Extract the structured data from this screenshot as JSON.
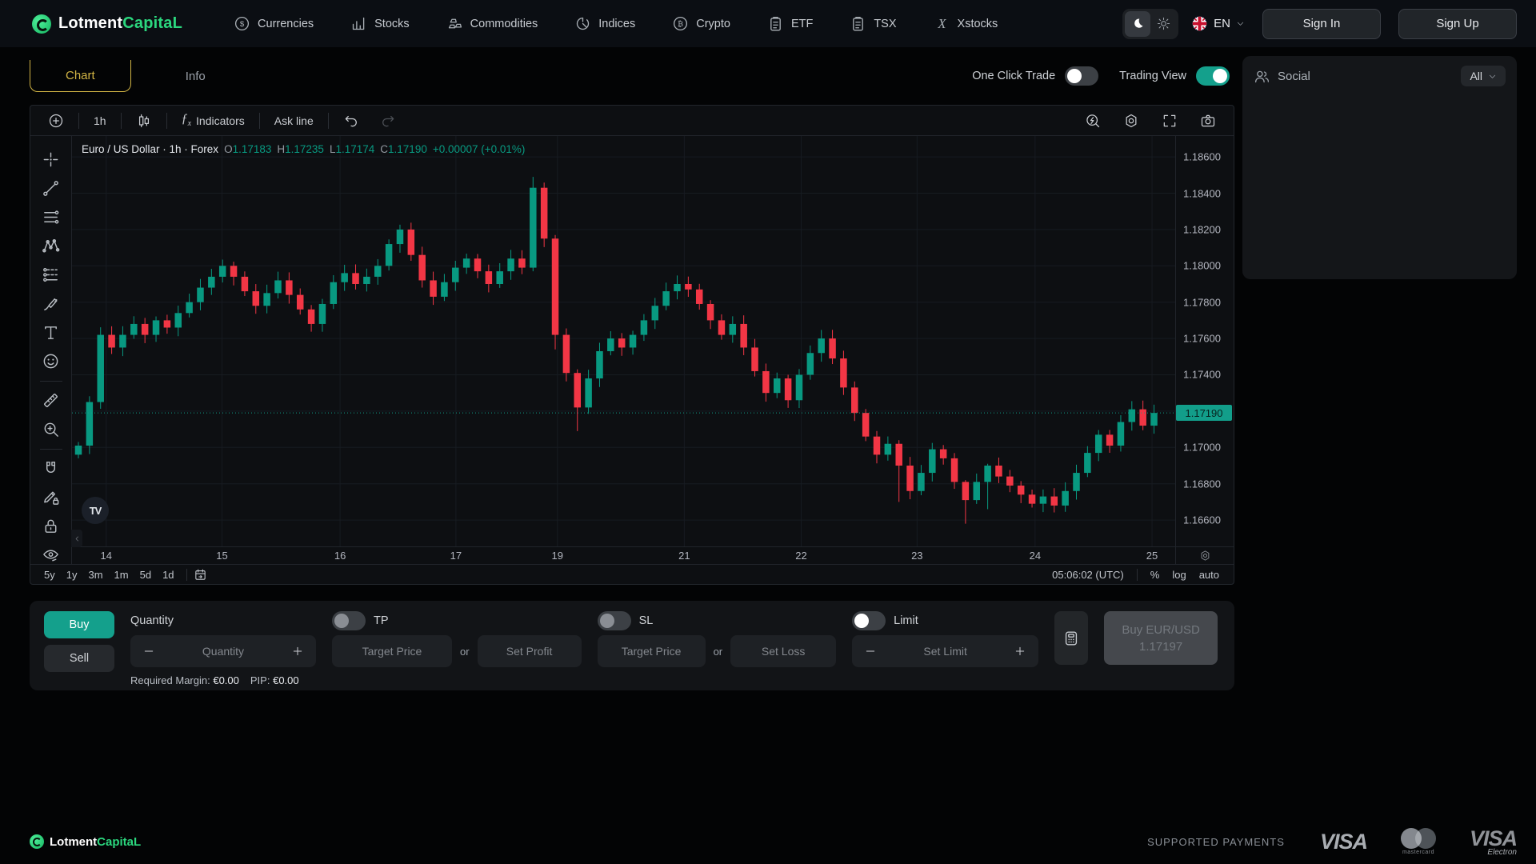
{
  "brand": {
    "primary": "Lotment",
    "secondary": "CapitaL"
  },
  "nav": {
    "items": [
      {
        "label": "Currencies",
        "icon": "coin-dollar"
      },
      {
        "label": "Stocks",
        "icon": "bar-chart"
      },
      {
        "label": "Commodities",
        "icon": "gold-bars"
      },
      {
        "label": "Indices",
        "icon": "donut-chart"
      },
      {
        "label": "Crypto",
        "icon": "bitcoin"
      },
      {
        "label": "ETF",
        "icon": "clipboard"
      },
      {
        "label": "TSX",
        "icon": "clipboard"
      },
      {
        "label": "Xstocks",
        "icon": "x-letter"
      }
    ],
    "language": "EN",
    "sign_in": "Sign In",
    "sign_up": "Sign Up"
  },
  "tabs": {
    "chart": "Chart",
    "info": "Info"
  },
  "head_toggles": {
    "one_click_trade": {
      "label": "One Click Trade",
      "on": false
    },
    "trading_view": {
      "label": "Trading View",
      "on": true
    }
  },
  "chart_toolbar": {
    "interval": "1h",
    "indicators": "Indicators",
    "ask_line": "Ask line"
  },
  "chart_data": {
    "type": "candlestick",
    "symbol": "Euro / US Dollar",
    "interval": "1h",
    "market": "Forex",
    "legend": {
      "title": "Euro / US Dollar · 1h · Forex",
      "o_key": "O",
      "o": "1.17183",
      "h_key": "H",
      "h": "1.17235",
      "l_key": "L",
      "l": "1.17174",
      "c_key": "C",
      "c": "1.17190",
      "change": "+0.00007 (+0.01%)"
    },
    "watermark": "TV",
    "current_price": 1.1719,
    "current_price_label": "1.17190",
    "price_top": 1.18715,
    "price_bottom": 1.16455,
    "open_first": 1.1696,
    "closes": [
      1.1701,
      1.1725,
      1.1762,
      1.1755,
      1.1762,
      1.1768,
      1.1762,
      1.177,
      1.1766,
      1.1774,
      1.178,
      1.1788,
      1.1794,
      1.18,
      1.1794,
      1.1786,
      1.1778,
      1.1785,
      1.1792,
      1.1784,
      1.1776,
      1.1768,
      1.1779,
      1.1791,
      1.1796,
      1.179,
      1.1794,
      1.18,
      1.1812,
      1.182,
      1.1806,
      1.1792,
      1.1783,
      1.1791,
      1.1799,
      1.1804,
      1.1797,
      1.179,
      1.1797,
      1.1804,
      1.1799,
      1.1843,
      1.1815,
      1.1762,
      1.1741,
      1.1722,
      1.1738,
      1.1753,
      1.176,
      1.1755,
      1.1762,
      1.177,
      1.1778,
      1.1786,
      1.179,
      1.1787,
      1.1779,
      1.177,
      1.1762,
      1.1768,
      1.1755,
      1.1742,
      1.173,
      1.1738,
      1.1726,
      1.174,
      1.1752,
      1.176,
      1.1749,
      1.1733,
      1.1719,
      1.1706,
      1.1696,
      1.1702,
      1.169,
      1.1676,
      1.1686,
      1.1699,
      1.1694,
      1.1681,
      1.1671,
      1.1681,
      1.169,
      1.1684,
      1.1679,
      1.1674,
      1.1669,
      1.1673,
      1.1668,
      1.1676,
      1.1686,
      1.1697,
      1.1707,
      1.1701,
      1.1714,
      1.1721,
      1.1712,
      1.1719
    ],
    "wick_overrides": {
      "41": [
        0.0006,
        0.0002
      ],
      "43": [
        0.0002,
        0.0008
      ],
      "45": [
        0.0002,
        0.0013
      ],
      "74": [
        0.0002,
        0.002
      ],
      "80": [
        0.0001,
        0.0013
      ],
      "82": [
        0.0001,
        0.0015
      ]
    },
    "y_ticks": [
      "1.18600",
      "1.18400",
      "1.18200",
      "1.18000",
      "1.17800",
      "1.17600",
      "1.17400",
      "1.17000",
      "1.16800",
      "1.16600"
    ],
    "x_ticks": [
      {
        "label": "14",
        "frac": 0.031
      },
      {
        "label": "15",
        "frac": 0.136
      },
      {
        "label": "16",
        "frac": 0.243
      },
      {
        "label": "17",
        "frac": 0.348
      },
      {
        "label": "19",
        "frac": 0.44
      },
      {
        "label": "21",
        "frac": 0.555
      },
      {
        "label": "22",
        "frac": 0.661
      },
      {
        "label": "23",
        "frac": 0.766
      },
      {
        "label": "24",
        "frac": 0.873
      },
      {
        "label": "25",
        "frac": 0.979
      }
    ],
    "colors": {
      "up": "#089981",
      "down": "#f23645",
      "grid": "#171b21",
      "price_line": "#129e8a"
    }
  },
  "chart_footer": {
    "ranges": [
      "5y",
      "1y",
      "3m",
      "1m",
      "5d",
      "1d"
    ],
    "clock": "05:06:02 (UTC)",
    "scales": [
      "%",
      "log",
      "auto"
    ]
  },
  "trade_panel": {
    "buy": "Buy",
    "sell": "Sell",
    "quantity_label": "Quantity",
    "quantity_placeholder": "Quantity",
    "required_margin_label": "Required Margin:",
    "required_margin_value": "€0.00",
    "pip_label": "PIP:",
    "pip_value": "€0.00",
    "tp_label": "TP",
    "tp_target_placeholder": "Target Price",
    "tp_or": "or",
    "tp_alt_placeholder": "Set Profit",
    "sl_label": "SL",
    "sl_target_placeholder": "Target Price",
    "sl_or": "or",
    "sl_alt_placeholder": "Set Loss",
    "limit_label": "Limit",
    "limit_placeholder": "Set Limit",
    "submit_line1": "Buy EUR/USD",
    "submit_line2": "1.17197"
  },
  "social": {
    "title": "Social",
    "filter": "All"
  },
  "footer": {
    "supported_payments": "SUPPORTED PAYMENTS",
    "visa": "VISA",
    "mastercard": "mastercard",
    "visa_electron_top": "VISA",
    "visa_electron_sub": "Electron"
  }
}
